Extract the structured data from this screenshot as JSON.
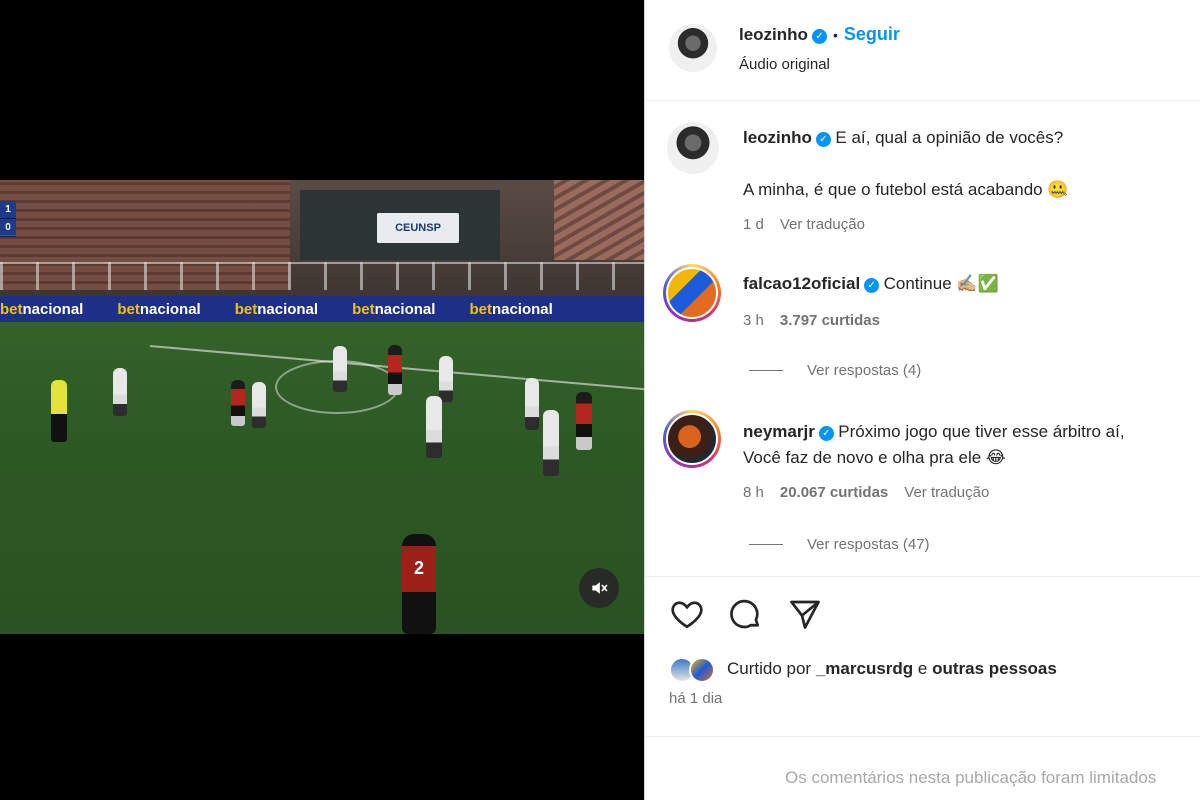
{
  "media": {
    "scoreboard": [
      "1",
      "0"
    ],
    "stadium_sign": "CEUNSP",
    "ad_brand_a": "bet",
    "ad_brand_b": "nacional",
    "jersey_number": "2"
  },
  "header": {
    "username": "leozinho",
    "follow_label": "Seguir",
    "separator": "•",
    "audio_label": "Áudio original"
  },
  "caption": {
    "username": "leozinho",
    "line1": "E aí, qual a opinião de vocês?",
    "line2": "A minha, é que o futebol está acabando 🤐",
    "time": "1 d",
    "translate": "Ver tradução"
  },
  "comments": [
    {
      "username": "falcao12oficial",
      "text": "Continue ✍🏼✅",
      "time": "3 h",
      "likes": "3.797 curtidas",
      "replies": "Ver respostas (4)"
    },
    {
      "username": "neymarjr",
      "text": "Próximo jogo que tiver esse árbitro aí,",
      "text2": "Você faz de novo e olha pra ele 😂",
      "time": "8 h",
      "likes": "20.067 curtidas",
      "translate": "Ver tradução",
      "replies": "Ver respostas (47)"
    }
  ],
  "likes_summary": {
    "prefix": "Curtido por",
    "user": "_marcusrdg",
    "conj": "e",
    "others": "outras pessoas"
  },
  "post_time": "há 1 dia",
  "footer": "Os comentários nesta publicação foram limitados"
}
